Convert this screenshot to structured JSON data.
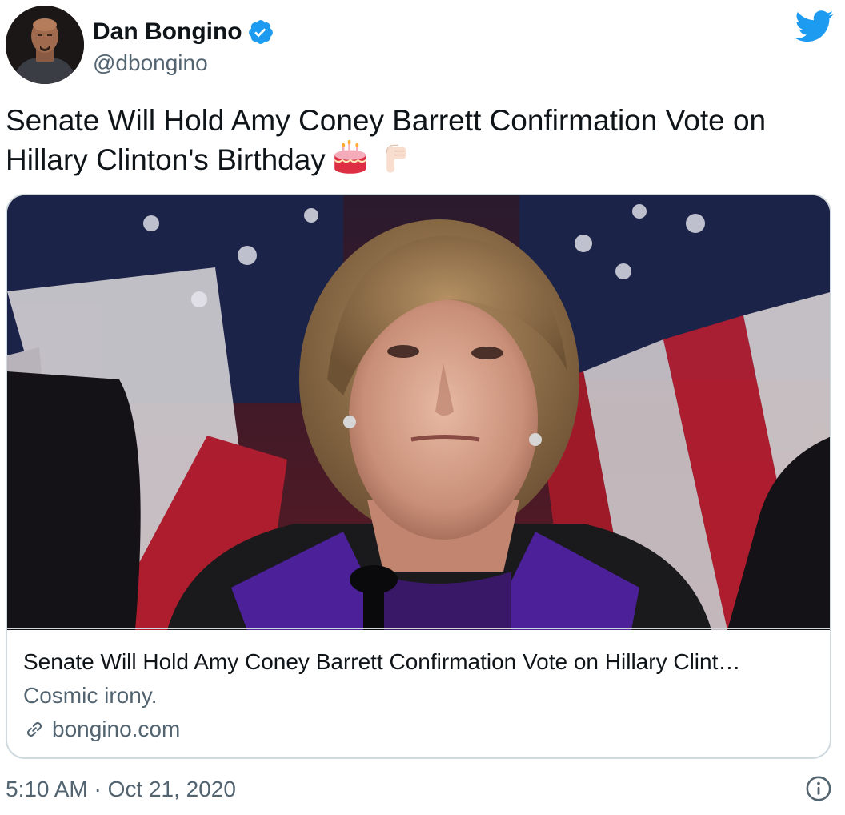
{
  "author": {
    "display_name": "Dan Bongino",
    "handle": "@dbongino",
    "verified": true,
    "avatar_icon": "avatar-photo"
  },
  "tweet": {
    "text": "Senate Will Hold Amy Coney Barrett Confirmation Vote on Hillary Clinton's Birthday",
    "emojis": [
      "birthday-cake-icon",
      "pointing-down-icon"
    ]
  },
  "card": {
    "image_icon": "article-photo",
    "title": "Senate Will Hold Amy Coney Barrett Confirmation Vote on Hillary Clint…",
    "description": "Cosmic irony.",
    "domain": "bongino.com"
  },
  "footer": {
    "time": "5:10 AM",
    "separator": "·",
    "date": "Oct 21, 2020"
  },
  "colors": {
    "twitter_blue": "#1d9bf0",
    "text_primary": "#0f1419",
    "text_secondary": "#536471",
    "border": "#cfd9de"
  }
}
